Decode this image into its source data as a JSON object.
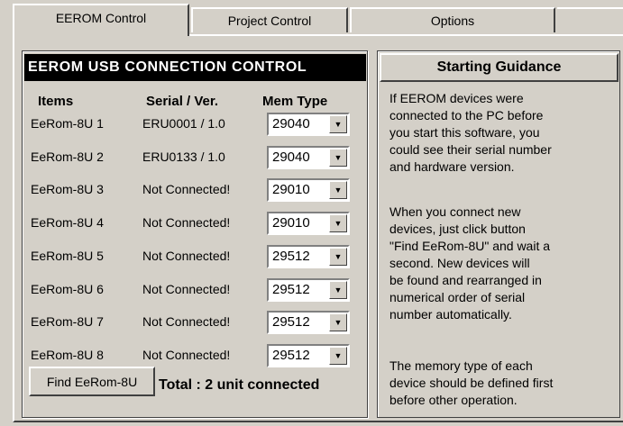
{
  "tabs": [
    {
      "label": "EEROM Control",
      "active": true
    },
    {
      "label": "Project Control",
      "active": false
    },
    {
      "label": "Options",
      "active": false
    }
  ],
  "connection_panel": {
    "title": "EEROM USB CONNECTION CONTROL",
    "headers": {
      "items": "Items",
      "serial": "Serial / Ver.",
      "mem_type": "Mem Type"
    },
    "rows": [
      {
        "item": "EeRom-8U 1",
        "serial": "ERU0001 / 1.0",
        "mem_type": "29040"
      },
      {
        "item": "EeRom-8U 2",
        "serial": "ERU0133 / 1.0",
        "mem_type": "29040"
      },
      {
        "item": "EeRom-8U 3",
        "serial": "Not Connected!",
        "mem_type": "29010"
      },
      {
        "item": "EeRom-8U 4",
        "serial": "Not Connected!",
        "mem_type": "29010"
      },
      {
        "item": "EeRom-8U 5",
        "serial": "Not Connected!",
        "mem_type": "29512"
      },
      {
        "item": "EeRom-8U 6",
        "serial": "Not Connected!",
        "mem_type": "29512"
      },
      {
        "item": "EeRom-8U 7",
        "serial": "Not Connected!",
        "mem_type": "29512"
      },
      {
        "item": "EeRom-8U 8",
        "serial": "Not Connected!",
        "mem_type": "29512"
      }
    ],
    "find_button_label": "Find EeRom-8U",
    "total_label": "Total : 2  unit connected"
  },
  "guidance": {
    "title": "Starting Guidance",
    "paragraphs": [
      [
        "  If EEROM devices were",
        "connected to the PC before",
        "you start this software, you",
        "could see their serial number",
        "and hardware version."
      ],
      [
        "  When you connect new",
        "devices, just click button",
        "\"Find  EeRom-8U\" and wait a",
        "second. New devices will",
        "be found and rearranged in",
        "numerical order of serial",
        "number automatically."
      ],
      [
        "  The memory type of each",
        "device should be defined first",
        "before other operation."
      ]
    ]
  },
  "colors": {
    "face": "#d4d0c8",
    "header_bg": "#000000",
    "header_fg": "#ffffff"
  }
}
